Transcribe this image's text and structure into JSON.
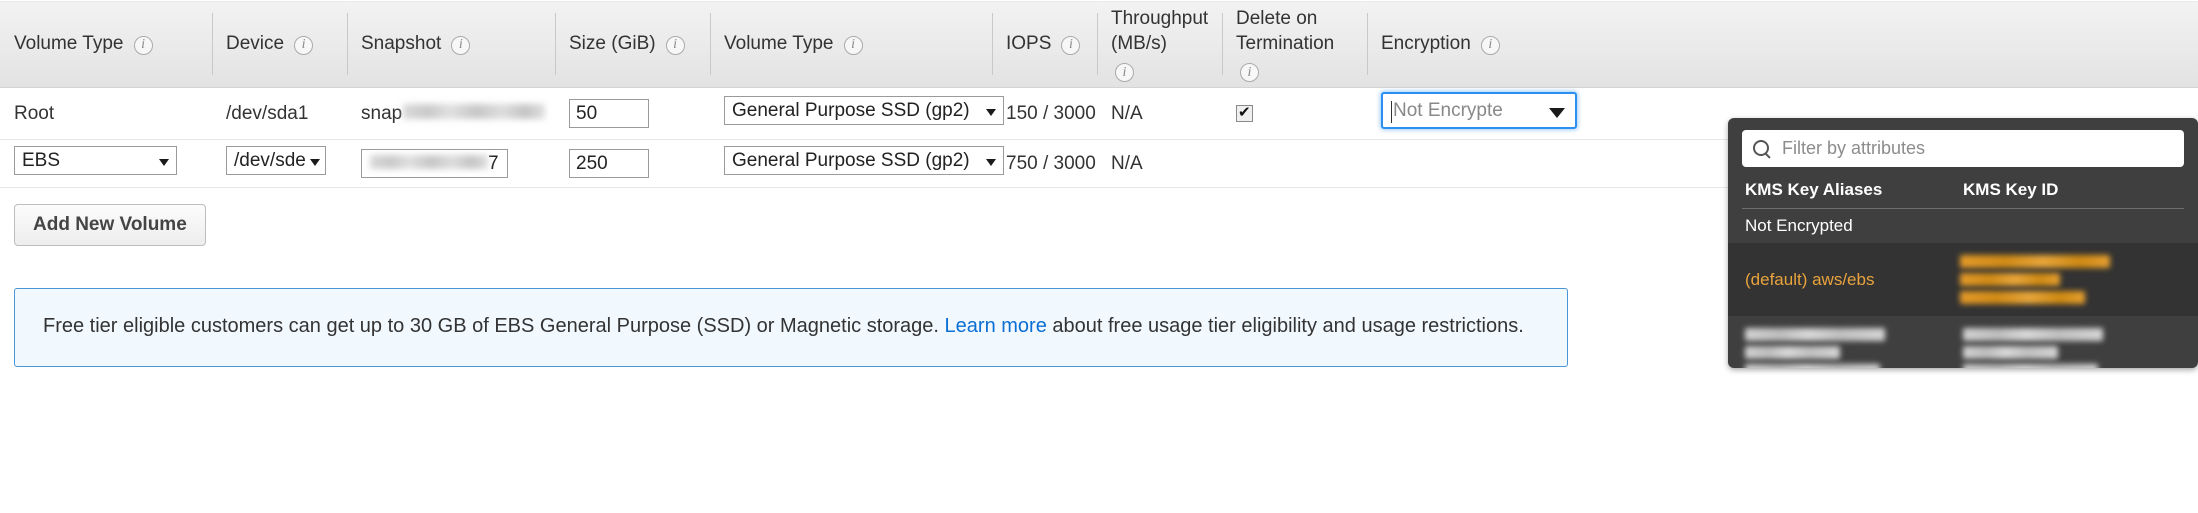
{
  "table": {
    "columns": [
      {
        "label": "Volume Type",
        "info": "info-icon"
      },
      {
        "label": "Device",
        "info": "info-icon"
      },
      {
        "label": "Snapshot",
        "info": "info-icon"
      },
      {
        "label": "Size (GiB)",
        "info": "info-icon"
      },
      {
        "label": "Volume Type",
        "info": "info-icon"
      },
      {
        "label": "IOPS",
        "info": "info-icon"
      },
      {
        "label": "Throughput\n(MB/s)",
        "info": "info-icon"
      },
      {
        "label": "Delete on\nTermination",
        "info": "info-icon"
      },
      {
        "label": "Encryption",
        "info": "info-icon"
      }
    ],
    "rows": [
      {
        "volume_type": "Root",
        "device": "/dev/sda1",
        "snapshot_prefix": "snap",
        "snapshot_redacted": true,
        "size": "50",
        "volume_type_2": "General Purpose SSD (gp2)",
        "iops": "150 / 3000",
        "throughput": "N/A",
        "delete_on_termination": true,
        "encryption": "Not Encrypte"
      },
      {
        "volume_type": "EBS",
        "device": "/dev/sde",
        "snapshot_suffix": "7",
        "snapshot_redacted": true,
        "size": "250",
        "volume_type_2": "General Purpose SSD (gp2)",
        "iops": "750 / 3000",
        "throughput": "N/A",
        "delete_on_termination": false,
        "encryption": ""
      }
    ]
  },
  "add_volume_button": "Add New Volume",
  "encryption_dropdown": {
    "filter_placeholder": "Filter by attributes",
    "search_icon": "search-icon",
    "columns": [
      "KMS Key Aliases",
      "KMS Key ID"
    ],
    "rows": [
      {
        "alias": "Not Encrypted",
        "key_id": "",
        "redacted": false,
        "selected": false
      },
      {
        "alias": "(default) aws/ebs",
        "key_id": "",
        "redacted": true,
        "selected": true
      },
      {
        "alias": "",
        "key_id": "",
        "redacted": true,
        "selected": false
      }
    ],
    "accent_color": "#e8a33d",
    "panel_bg": "#3f3f3f"
  },
  "notice": {
    "text_before_link": "Free tier eligible customers can get up to 30 GB of EBS General Purpose (SSD) or Magnetic storage. ",
    "link_text": "Learn more",
    "text_after_link": " about free usage tier eligibility and usage restrictions.",
    "border_color": "#4a95d6",
    "background_color": "#f1f8fe",
    "link_color": "#0b6fd4"
  }
}
